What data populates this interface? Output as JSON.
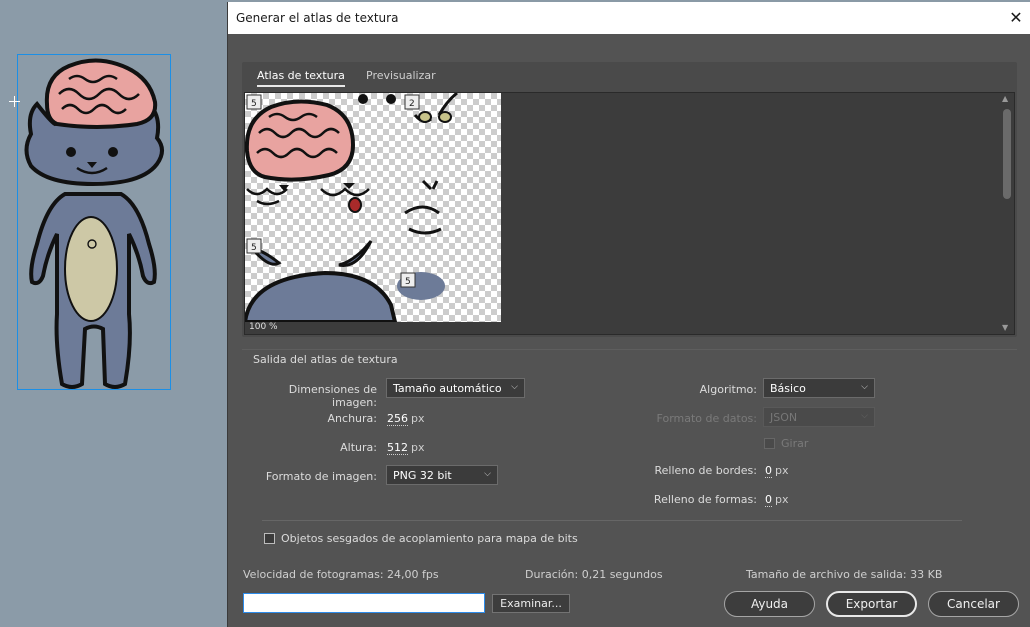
{
  "dialog": {
    "title": "Generar el atlas de textura",
    "close_icon": "close-icon"
  },
  "tabs": [
    {
      "label": "Atlas de textura",
      "active": true
    },
    {
      "label": "Previsualizar",
      "active": false
    }
  ],
  "preview": {
    "zoom": "100 %",
    "badges": [
      "5",
      "2",
      "5",
      "5"
    ]
  },
  "output": {
    "group_title": "Salida del atlas de textura",
    "image_dimensions": {
      "label": "Dimensiones de imagen:",
      "value": "Tamaño automático"
    },
    "width": {
      "label": "Anchura:",
      "value": "256",
      "unit": "px"
    },
    "height": {
      "label": "Altura:",
      "value": "512",
      "unit": "px"
    },
    "image_format": {
      "label": "Formato de imagen:",
      "value": "PNG 32 bit"
    },
    "algorithm": {
      "label": "Algoritmo:",
      "value": "Básico"
    },
    "data_format": {
      "label": "Formato de datos:",
      "value": "JSON"
    },
    "rotate": {
      "label": "Girar"
    },
    "border_padding": {
      "label": "Relleno de bordes:",
      "value": "0",
      "unit": "px"
    },
    "shape_padding": {
      "label": "Relleno de formas:",
      "value": "0",
      "unit": "px"
    },
    "bitmap_option": {
      "label": "Objetos sesgados de acoplamiento para mapa de bits",
      "checked": false
    }
  },
  "stats": {
    "fps": "Velocidad de fotogramas: 24,00 fps",
    "duration": "Duración: 0,21 segundos",
    "size": "Tamaño de archivo de salida: 33 KB"
  },
  "footer": {
    "path_value": "",
    "browse_label": "Examinar...",
    "help_label": "Ayuda",
    "export_label": "Exportar",
    "cancel_label": "Cancelar"
  },
  "colors": {
    "dialog_bg": "#535353",
    "stage_bg": "#8b9ba8",
    "selection": "#1c8fe6",
    "accent_input": "#2d8ceb"
  }
}
